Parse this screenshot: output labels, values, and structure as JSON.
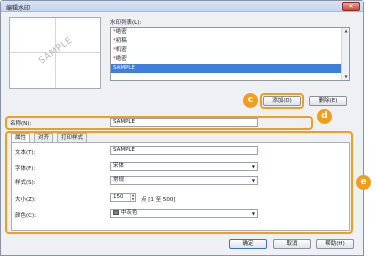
{
  "window": {
    "title": "编辑水印"
  },
  "preview": {
    "watermark_text": "SAMPLE"
  },
  "list": {
    "label": "水印列表(L):",
    "items": [
      {
        "star": "*",
        "text": "绝密",
        "selected": false
      },
      {
        "star": "*",
        "text": "初稿",
        "selected": false
      },
      {
        "star": "*",
        "text": "机密",
        "selected": false
      },
      {
        "star": "*",
        "text": "绝密",
        "selected": false
      },
      {
        "star": "",
        "text": "SAMPLE",
        "selected": true
      }
    ]
  },
  "buttons": {
    "add": "添加(D)",
    "delete": "删除(E)",
    "ok": "确定",
    "cancel": "取消",
    "help": "帮助(H)"
  },
  "callouts": {
    "c": "c",
    "d": "d",
    "e": "e"
  },
  "name_field": {
    "label": "名称(N):",
    "value": "SAMPLE"
  },
  "tabs": [
    "属性",
    "对齐",
    "打印样式"
  ],
  "properties": {
    "text_label": "文本(T):",
    "text_value": "SAMPLE",
    "font_label": "字体(F):",
    "font_value": "宋体",
    "style_label": "样式(S):",
    "style_value": "常规",
    "size_label": "大小(Z):",
    "size_value": "150",
    "size_range": "点 [1 至 500]",
    "color_label": "颜色(C):",
    "color_value": "中灰色",
    "color_hex": "#808080"
  },
  "colors": {
    "accent": "#f19d1f",
    "selection": "#3d7fdb"
  }
}
